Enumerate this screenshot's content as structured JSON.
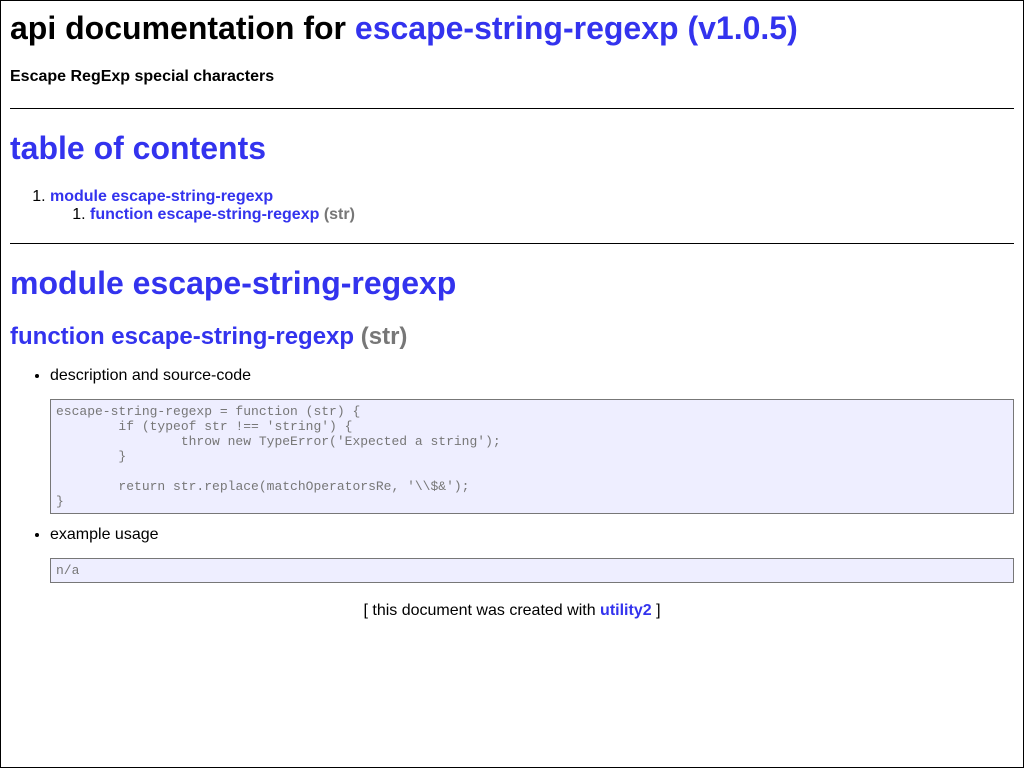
{
  "header": {
    "title_prefix": "api documentation for",
    "title_link": "escape-string-regexp (v1.0.5)",
    "subtitle": "Escape RegExp special characters"
  },
  "toc": {
    "title": "table of contents",
    "module_link": "module escape-string-regexp",
    "function_link": "function escape-string-regexp",
    "function_signature": "(str)"
  },
  "module": {
    "title": "module escape-string-regexp",
    "function_title": "function escape-string-regexp",
    "function_signature": "(str)",
    "description_label": "description and source-code",
    "source_code": "escape-string-regexp = function (str) {\n\tif (typeof str !== 'string') {\n\t\tthrow new TypeError('Expected a string');\n\t}\n\n\treturn str.replace(matchOperatorsRe, '\\\\$&');\n}",
    "example_label": "example usage",
    "example_code": "n/a"
  },
  "footer": {
    "text_before": "[ this document was created with",
    "link": "utility2",
    "text_after": "]"
  },
  "colors": {
    "link": "#3333ee",
    "muted": "#777777",
    "code_background": "#eeeeff"
  }
}
